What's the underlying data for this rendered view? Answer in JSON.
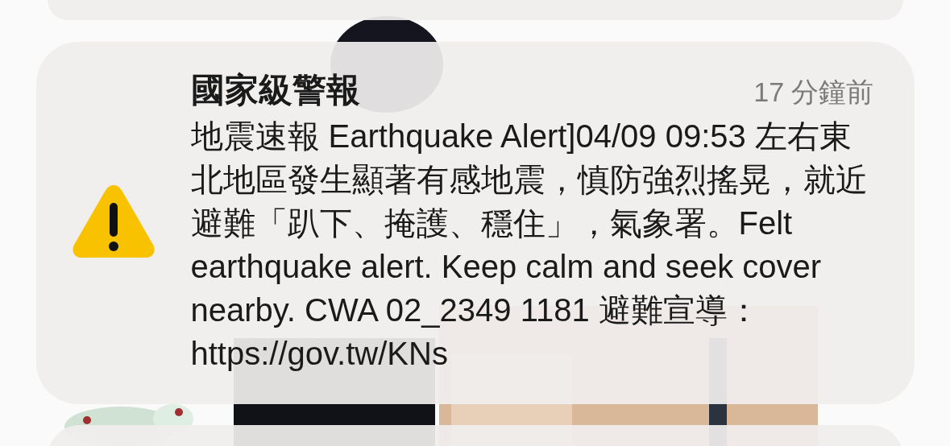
{
  "alert": {
    "app": "國家級警報",
    "time": "17 分鐘前",
    "message": "地震速報 Earthquake Alert]04/09 09:53 左右東北地區發生顯著有感地震，慎防強烈搖晃，就近避難「趴下、掩護、穩住」，氣象署。Felt earthquake alert. Keep calm and seek cover nearby. CWA 02_2349 1181 避難宣導：https://gov.tw/KNs"
  }
}
